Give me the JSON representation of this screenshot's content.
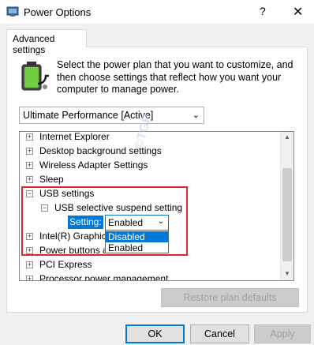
{
  "window": {
    "title": "Power Options",
    "help_glyph": "?",
    "close_glyph": "✕"
  },
  "tab": {
    "label": "Advanced settings"
  },
  "description": "Select the power plan that you want to customize, and then choose settings that reflect how you want your computer to manage power.",
  "plan_select": {
    "value": "Ultimate Performance [Active]",
    "arrow": "⌄"
  },
  "tree": {
    "items": [
      {
        "label": "Internet Explorer",
        "expander": "+"
      },
      {
        "label": "Desktop background settings",
        "expander": "+"
      },
      {
        "label": "Wireless Adapter Settings",
        "expander": "+"
      },
      {
        "label": "Sleep",
        "expander": "+"
      },
      {
        "label": "USB settings",
        "expander": "−"
      },
      {
        "label": "USB selective suspend setting",
        "expander": "−"
      },
      {
        "label": "Intel(R) Graphics Settings",
        "expander": "+"
      },
      {
        "label": "Power buttons and lid",
        "expander": "+"
      },
      {
        "label": "PCI Express",
        "expander": "+"
      },
      {
        "label": "Processor power management",
        "expander": "+"
      }
    ],
    "setting": {
      "label": "Setting:",
      "value": "Enabled",
      "arrow": "⌄"
    },
    "options": [
      "Disabled",
      "Enabled"
    ],
    "highlighted_option": "Disabled"
  },
  "watermark": "©TGP",
  "buttons": {
    "restore": "Restore plan defaults",
    "ok": "OK",
    "cancel": "Cancel",
    "apply": "Apply"
  },
  "colors": {
    "accent": "#0078d7",
    "highlight_border": "#e0262c"
  }
}
